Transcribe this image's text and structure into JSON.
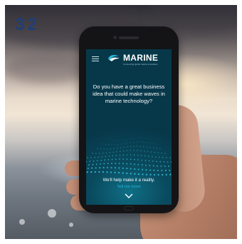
{
  "page_number": "32",
  "app": {
    "brand": "MARINE",
    "brand_tagline": "Connecting global marine innovation"
  },
  "hero": {
    "headline": "Do you have a great business idea that could make waves in marine technology?",
    "tagline": "We'll help make it a reality.",
    "cta_label": "Tell me more"
  },
  "colors": {
    "screen_bg": "#07384a",
    "accent": "#22b8d8",
    "page_number": "#1f3f78"
  },
  "icons": {
    "menu": "hamburger-icon",
    "logo": "wave-logo-icon",
    "scroll": "chevron-down-icon"
  }
}
